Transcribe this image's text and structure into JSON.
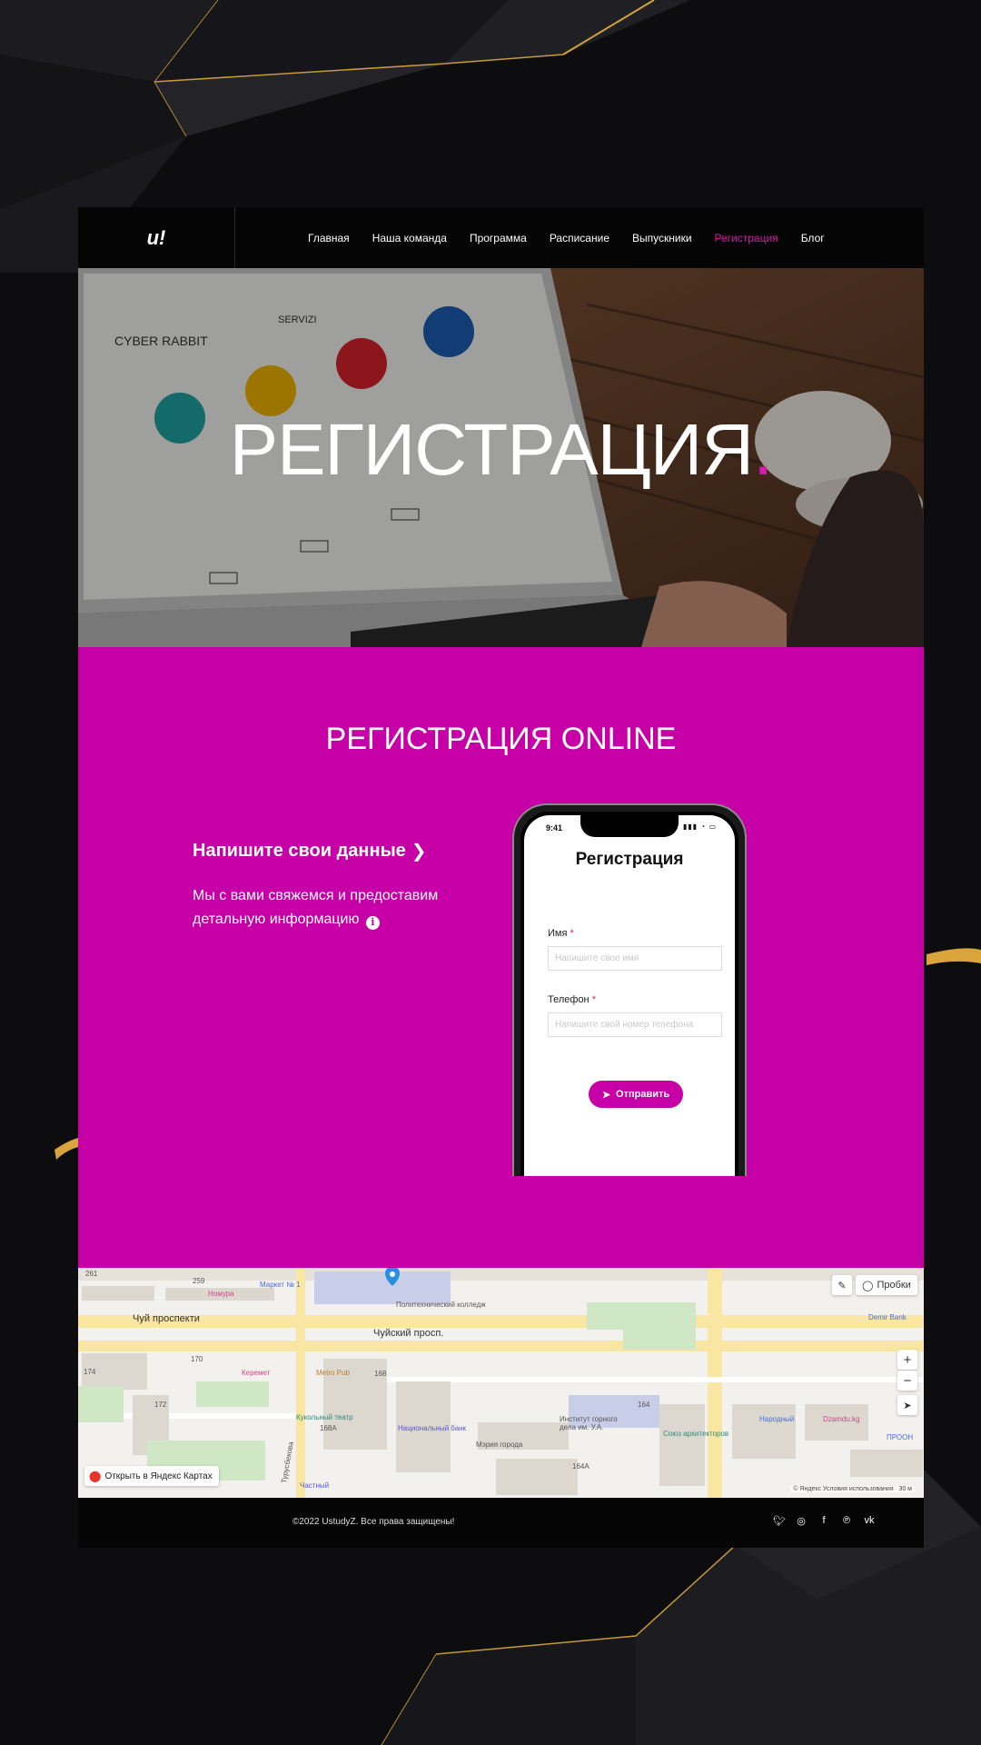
{
  "header": {
    "logo": "u!",
    "nav": [
      {
        "label": "Главная"
      },
      {
        "label": "Наша команда"
      },
      {
        "label": "Программа"
      },
      {
        "label": "Расписание"
      },
      {
        "label": "Выпускники"
      },
      {
        "label": "Регистрация",
        "active": true
      },
      {
        "label": "Блог"
      }
    ]
  },
  "hero": {
    "title": "РЕГИСТРАЦИЯ",
    "dot": "."
  },
  "registration": {
    "title": "РЕГИСТРАЦИЯ ONLINE",
    "heading": "Напишите свои данные",
    "text": "Мы с вами свяжемся и предоставим детальную информацию"
  },
  "phone": {
    "time": "9:41",
    "form_title": "Регистрация",
    "name_label": "Имя",
    "name_placeholder": "Напишите свое имя",
    "phone_label": "Телефон",
    "phone_placeholder": "Напишите свой номер телефона",
    "required_mark": "*",
    "submit_label": "Отправить"
  },
  "map": {
    "open_link": "Открыть в Яндекс Картах",
    "traffic_label": "Пробки",
    "streets": [
      "Чуй проспекти",
      "Чуйский просп.",
      "Турусбекова"
    ],
    "places": [
      "Маркет № 1",
      "Номура",
      "Керемет",
      "Metro Pub",
      "Кукольный театр",
      "Национальный банк",
      "Мэрия города",
      "Институт горного дела им. У.А.",
      "Союз архитекторов",
      "Народный",
      "Dzamdu.kg",
      "ПРООН",
      "Demir Bank",
      "Частный",
      "Политехнический колледж"
    ],
    "numbers": [
      "261",
      "259",
      "170",
      "174",
      "172",
      "168",
      "168А",
      "164",
      "164А"
    ],
    "copyright": "© Яндекс   Условия использования",
    "scale": "30 м"
  },
  "footer": {
    "copyright": "©2022 UstudyZ. Все права защищены!",
    "socials": [
      "twitter-icon",
      "instagram-icon",
      "facebook-icon",
      "pinterest-icon",
      "vk-icon"
    ]
  },
  "colors": {
    "accent": "#c600a6",
    "nav_active": "#d61aa9",
    "header_bg": "#050505"
  }
}
